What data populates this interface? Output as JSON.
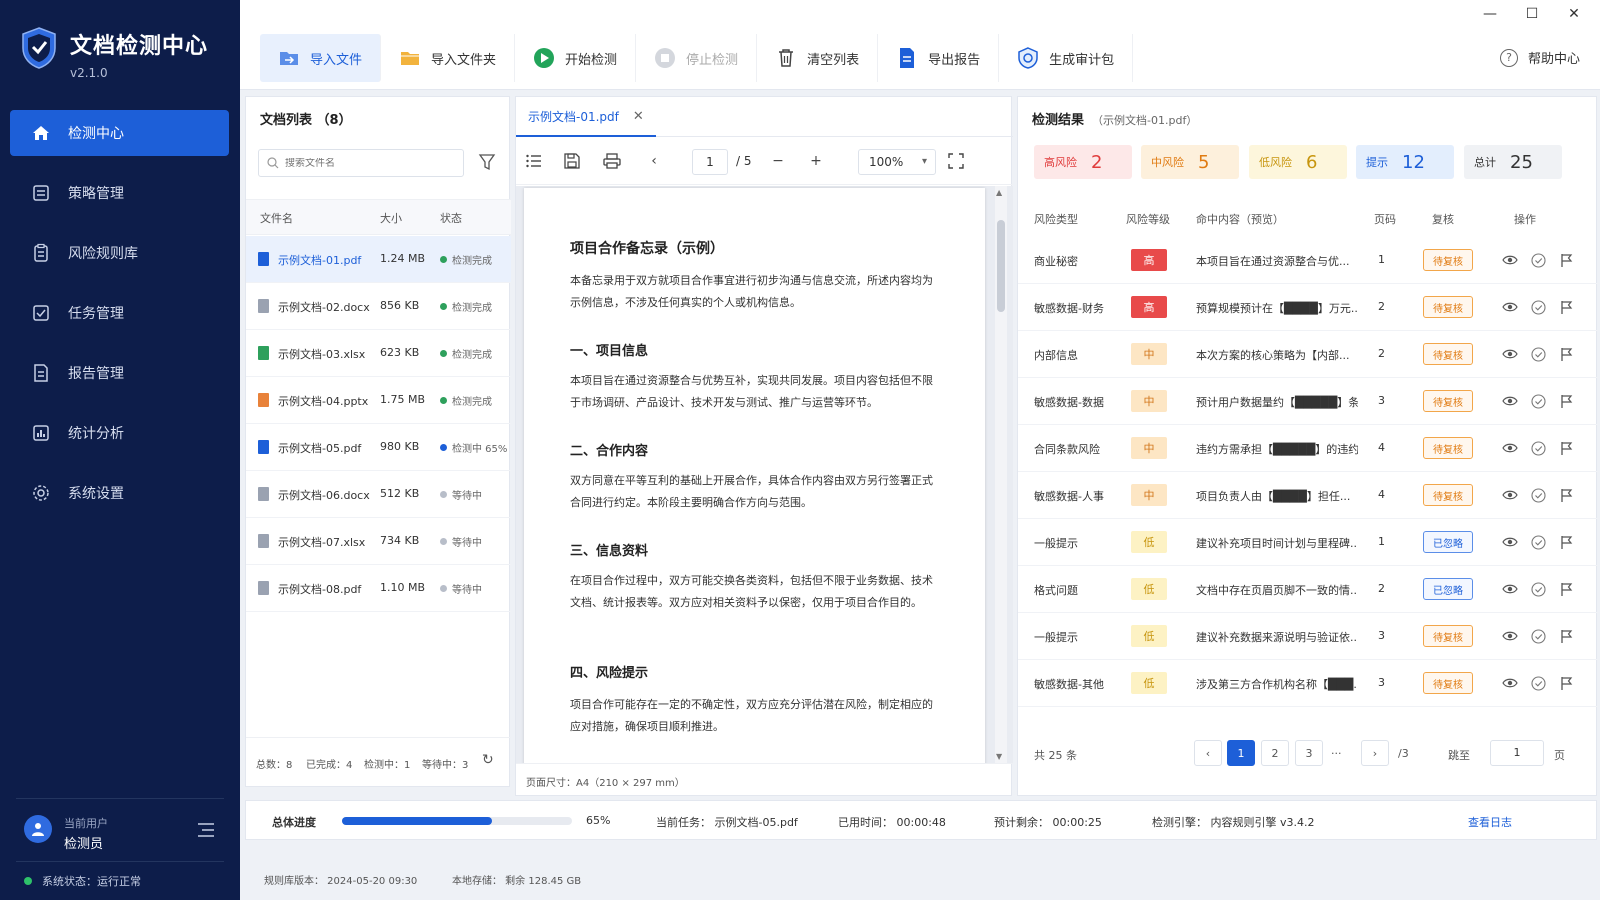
{
  "app": {
    "title": "文档检测中心",
    "version": "v2.1.0"
  },
  "sidebar": {
    "items": [
      {
        "label": "检测中心",
        "icon": "home-icon",
        "active": true
      },
      {
        "label": "策略管理",
        "icon": "policy-icon"
      },
      {
        "label": "风险规则库",
        "icon": "rules-icon"
      },
      {
        "label": "任务管理",
        "icon": "task-icon"
      },
      {
        "label": "报告管理",
        "icon": "report-icon"
      },
      {
        "label": "统计分析",
        "icon": "stats-icon"
      },
      {
        "label": "系统设置",
        "icon": "gear-icon"
      }
    ],
    "user_label": "当前用户",
    "user_name": "检测员",
    "system_status": "系统状态：运行正常"
  },
  "toolbar": {
    "buttons": [
      {
        "label": "导入文件",
        "icon": "import-file-icon"
      },
      {
        "label": "导入文件夹",
        "icon": "folder-icon"
      },
      {
        "label": "开始检测",
        "icon": "play-icon"
      },
      {
        "label": "停止检测",
        "icon": "stop-icon"
      },
      {
        "label": "清空列表",
        "icon": "trash-icon"
      },
      {
        "label": "导出报告",
        "icon": "export-icon"
      },
      {
        "label": "生成审计包",
        "icon": "audit-icon"
      }
    ],
    "help": "帮助中心"
  },
  "file_list": {
    "title": "文档列表 （8）",
    "search_placeholder": "搜索文件名",
    "columns": [
      "文件名",
      "大小",
      "状态"
    ],
    "rows": [
      {
        "name": "示例文档-01.pdf",
        "size": "1.24 MB",
        "status": "检测完成",
        "color": "#1d5fd8"
      },
      {
        "name": "示例文档-02.docx",
        "size": "856 KB",
        "status": "检测完成",
        "color": "#9aa2b1"
      },
      {
        "name": "示例文档-03.xlsx",
        "size": "623 KB",
        "status": "检测完成",
        "color": "#2ea05c"
      },
      {
        "name": "示例文档-04.pptx",
        "size": "1.75 MB",
        "status": "检测完成",
        "color": "#e8823a"
      },
      {
        "name": "示例文档-05.pdf",
        "size": "980 KB",
        "status": "检测中 65%",
        "color": "#1d5fd8"
      },
      {
        "name": "示例文档-06.docx",
        "size": "512 KB",
        "status": "等待中",
        "color": "#9aa2b1"
      },
      {
        "name": "示例文档-07.xlsx",
        "size": "734 KB",
        "status": "等待中",
        "color": "#9aa2b1"
      },
      {
        "name": "示例文档-08.pdf",
        "size": "1.10 MB",
        "status": "等待中",
        "color": "#9aa2b1"
      }
    ],
    "footer": {
      "total": "总数：8",
      "done": "已完成：4",
      "running": "检测中：1",
      "waiting": "等待中：3"
    }
  },
  "preview": {
    "tab": "示例文档-01.pdf",
    "page": "1",
    "pages": "/ 5",
    "zoom": "100%",
    "doc_title": "项目合作备忘录（示例）",
    "intro": "本备忘录用于双方就项目合作事宜进行初步沟通与信息交流，所述内容均为示例信息，不涉及任何真实的个人或机构信息。",
    "sections": [
      {
        "heading": "一、项目信息",
        "body": "本项目旨在通过资源整合与优势互补，实现共同发展。项目内容包括但不限于市场调研、产品设计、技术开发与测试、推广与运营等环节。"
      },
      {
        "heading": "二、合作内容",
        "body": "双方同意在平等互利的基础上开展合作，具体合作内容由双方另行签署正式合同进行约定。本阶段主要明确合作方向与范围。"
      },
      {
        "heading": "三、信息资料",
        "body": "在项目合作过程中，双方可能交换各类资料，包括但不限于业务数据、技术文档、统计报表等。双方应对相关资料予以保密，仅用于项目合作目的。"
      },
      {
        "heading": "四、风险提示",
        "body": "项目合作可能存在一定的不确定性，双方应充分评估潜在风险，制定相应的应对措施，确保项目顺利推进。"
      }
    ],
    "page_size": "页面尺寸：A4（210 × 297 mm）"
  },
  "results": {
    "title": "检测结果",
    "file": "（示例文档-01.pdf）",
    "summary": [
      {
        "label": "高风险",
        "value": "2",
        "bg": "#fde8e8",
        "fg": "#e03b3b"
      },
      {
        "label": "中风险",
        "value": "5",
        "bg": "#fdf0dc",
        "fg": "#e07b12"
      },
      {
        "label": "低风险",
        "value": "6",
        "bg": "#fdf6dc",
        "fg": "#c7950e"
      },
      {
        "label": "提示",
        "value": "12",
        "bg": "#e3eefd",
        "fg": "#1d5fd8"
      },
      {
        "label": "总计",
        "value": "25",
        "bg": "#f0f2f5",
        "fg": "#333333"
      }
    ],
    "columns": [
      "风险类型",
      "风险等级",
      "命中内容（预览）",
      "页码",
      "复核",
      "操作"
    ],
    "rows": [
      {
        "type": "商业秘密",
        "level": "高",
        "cls": "high",
        "content": "本项目旨在通过资源整合与优...",
        "page": "1",
        "review": "待复核",
        "rcls": "pending"
      },
      {
        "type": "敏感数据-财务",
        "level": "高",
        "cls": "high",
        "content": "预算规模预计在【████】万元...",
        "page": "2",
        "review": "待复核",
        "rcls": "pending"
      },
      {
        "type": "内部信息",
        "level": "中",
        "cls": "mid",
        "content": "本次方案的核心策略为【内部...",
        "page": "2",
        "review": "待复核",
        "rcls": "pending"
      },
      {
        "type": "敏感数据-数据",
        "level": "中",
        "cls": "mid",
        "content": "预计用户数据量约【█████】条...",
        "page": "3",
        "review": "待复核",
        "rcls": "pending"
      },
      {
        "type": "合同条款风险",
        "level": "中",
        "cls": "mid",
        "content": "违约方需承担【█████】的违约...",
        "page": "4",
        "review": "待复核",
        "rcls": "pending"
      },
      {
        "type": "敏感数据-人事",
        "level": "中",
        "cls": "mid",
        "content": "项目负责人由【████】担任...",
        "page": "4",
        "review": "待复核",
        "rcls": "pending"
      },
      {
        "type": "一般提示",
        "level": "低",
        "cls": "low",
        "content": "建议补充项目时间计划与里程碑...",
        "page": "1",
        "review": "已忽略",
        "rcls": "ignored"
      },
      {
        "type": "格式问题",
        "level": "低",
        "cls": "low",
        "content": "文档中存在页眉页脚不一致的情...",
        "page": "2",
        "review": "已忽略",
        "rcls": "ignored"
      },
      {
        "type": "一般提示",
        "level": "低",
        "cls": "low",
        "content": "建议补充数据来源说明与验证依...",
        "page": "3",
        "review": "待复核",
        "rcls": "pending"
      },
      {
        "type": "敏感数据-其他",
        "level": "低",
        "cls": "low",
        "content": "涉及第三方合作机构名称【███...",
        "page": "3",
        "review": "待复核",
        "rcls": "pending"
      }
    ],
    "pager": {
      "total": "共 25 条",
      "pages": [
        "1",
        "2",
        "3"
      ],
      "ellipsis": "···",
      "page_count": "/3",
      "jump_label": "跳至",
      "jump_value": "1",
      "page_suffix": "页"
    }
  },
  "progress": {
    "label": "总体进度",
    "value": 0.65,
    "percent": "65%",
    "task": "当前任务：  示例文档-05.pdf",
    "elapsed": "已用时间：  00:00:48",
    "remaining": "预计剩余：  00:00:25",
    "engine": "检测引擎：  内容规则引擎 v3.4.2",
    "log": "查看日志"
  },
  "status": {
    "rules": "规则库版本：  2024-05-20 09:30",
    "storage": "本地存储：  剩余 128.45 GB"
  },
  "colors": {
    "sidebar": "#0d1d4a",
    "accent": "#1d5fd8",
    "high": "#e84a4a"
  }
}
